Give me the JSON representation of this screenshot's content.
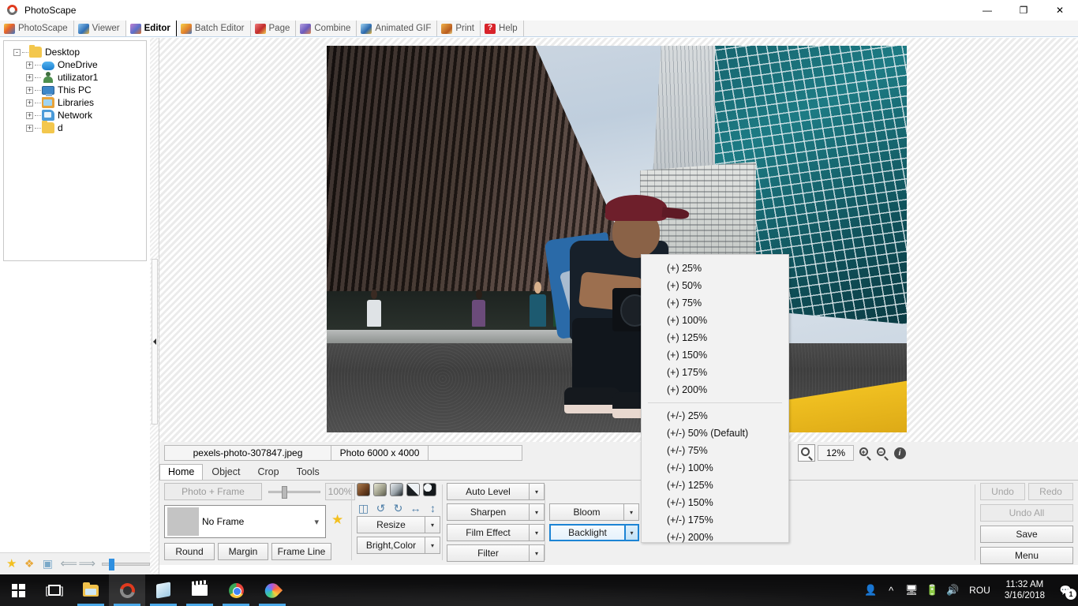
{
  "window": {
    "title": "PhotoScape",
    "app_icon": "photoscape-logo-icon",
    "controls": {
      "minimize": "—",
      "restore": "❐",
      "close": "✕"
    }
  },
  "module_tabs": [
    {
      "label": "PhotoScape",
      "icon": "photoscape-icon",
      "active": false
    },
    {
      "label": "Viewer",
      "icon": "viewer-icon",
      "active": false
    },
    {
      "label": "Editor",
      "icon": "editor-icon",
      "active": true
    },
    {
      "label": "Batch Editor",
      "icon": "batch-editor-icon",
      "active": false
    },
    {
      "label": "Page",
      "icon": "page-icon",
      "active": false
    },
    {
      "label": "Combine",
      "icon": "combine-icon",
      "active": false
    },
    {
      "label": "Animated GIF",
      "icon": "animated-gif-icon",
      "active": false
    },
    {
      "label": "Print",
      "icon": "print-icon",
      "active": false
    },
    {
      "label": "Help",
      "icon": "help-icon",
      "active": false
    }
  ],
  "file_tree": [
    {
      "label": "Desktop",
      "icon": "folder-icon",
      "depth": 0,
      "expander": "-"
    },
    {
      "label": "OneDrive",
      "icon": "onedrive-icon",
      "depth": 1,
      "expander": "+"
    },
    {
      "label": "utilizator1",
      "icon": "user-icon",
      "depth": 1,
      "expander": "+"
    },
    {
      "label": "This PC",
      "icon": "this-pc-icon",
      "depth": 1,
      "expander": "+"
    },
    {
      "label": "Libraries",
      "icon": "libraries-icon",
      "depth": 1,
      "expander": "+"
    },
    {
      "label": "Network",
      "icon": "network-icon",
      "depth": 1,
      "expander": "+"
    },
    {
      "label": "d",
      "icon": "folder-icon",
      "depth": 1,
      "expander": "+"
    }
  ],
  "left_strip_icons": [
    "favorites-star-icon",
    "plugin-puzzle-icon",
    "screen-capture-icon",
    "back-arrow-icon",
    "forward-arrow-icon"
  ],
  "status": {
    "filename": "pexels-photo-307847.jpeg",
    "dimensions": "Photo 6000 x 4000",
    "extra": "",
    "zoom_value": "12%",
    "zoom_icons": [
      "fit-to-window-icon",
      "zoom-in-icon",
      "zoom-out-icon",
      "image-info-icon"
    ]
  },
  "editor": {
    "tabs": [
      {
        "label": "Home",
        "active": true
      },
      {
        "label": "Object",
        "active": false
      },
      {
        "label": "Crop",
        "active": false
      },
      {
        "label": "Tools",
        "active": false
      }
    ],
    "photo_frame": {
      "button_label": "Photo + Frame",
      "button_disabled": true,
      "percent": "100%",
      "frame_select_value": "No Frame",
      "favorite_icon": "favorite-star-icon"
    },
    "frame_buttons": [
      "Round",
      "Margin",
      "Frame Line"
    ],
    "swatches": [
      "sepia-gradient-swatch",
      "olive-gradient-swatch",
      "steel-gradient-swatch",
      "diagonal-split-swatch",
      "circle-invert-swatch"
    ],
    "transform_icons": [
      "deskew-icon",
      "rotate-left-icon",
      "rotate-right-icon",
      "flip-horizontal-icon",
      "flip-vertical-icon"
    ],
    "column_a": [
      {
        "label": "Resize",
        "has_dropdown": true,
        "active": false
      },
      {
        "label": "Bright,Color",
        "has_dropdown": true,
        "active": false
      }
    ],
    "column_b": [
      {
        "label": "Auto Level",
        "has_dropdown": true,
        "active": false
      },
      {
        "label": "Sharpen",
        "has_dropdown": true,
        "active": false
      },
      {
        "label": "Film Effect",
        "has_dropdown": true,
        "active": false
      },
      {
        "label": "Filter",
        "has_dropdown": true,
        "active": false
      }
    ],
    "column_c": [
      {
        "label": "Bloom",
        "has_dropdown": true,
        "active": false
      },
      {
        "label": "Backlight",
        "has_dropdown": true,
        "active": true
      }
    ],
    "right_buttons": {
      "undo": "Undo",
      "redo": "Redo",
      "undo_all": "Undo All",
      "save": "Save",
      "menu": "Menu",
      "undo_disabled": true,
      "redo_disabled": true,
      "undo_all_disabled": true
    }
  },
  "context_menu": {
    "group_plus": [
      "(+) 25%",
      "(+) 50%",
      "(+) 75%",
      "(+) 100%",
      "(+) 125%",
      "(+) 150%",
      "(+) 175%",
      "(+) 200%"
    ],
    "group_plusminus": [
      "(+/-) 25%",
      "(+/-) 50% (Default)",
      "(+/-) 75%",
      "(+/-) 100%",
      "(+/-) 125%",
      "(+/-) 150%",
      "(+/-) 175%",
      "(+/-) 200%"
    ]
  },
  "taskbar": {
    "items": [
      {
        "name": "start-button",
        "icon": "windows-logo-icon",
        "running": false,
        "active": false
      },
      {
        "name": "task-view-button",
        "icon": "task-view-icon",
        "running": false,
        "active": false
      },
      {
        "name": "file-explorer",
        "icon": "file-explorer-icon",
        "running": true,
        "active": false
      },
      {
        "name": "photoscape-task",
        "icon": "photoscape-icon",
        "running": true,
        "active": true
      },
      {
        "name": "store-task",
        "icon": "microsoft-store-icon",
        "running": true,
        "active": false
      },
      {
        "name": "movies-task",
        "icon": "movies-tv-icon",
        "running": true,
        "active": false
      },
      {
        "name": "chrome-task",
        "icon": "chrome-icon",
        "running": true,
        "active": false
      },
      {
        "name": "photos-task",
        "icon": "photos-icon",
        "running": true,
        "active": false
      }
    ],
    "tray": {
      "people_icon": "people-icon",
      "chevron_icon": "show-hidden-icons-icon",
      "network_icon": "network-icon",
      "battery_icon": "battery-icon",
      "volume_icon": "volume-icon",
      "language": "ROU",
      "time": "11:32 AM",
      "date": "3/16/2018",
      "notifications_icon": "action-center-icon",
      "notifications_count": "1"
    }
  },
  "colors": {
    "accent": "#1c84d4",
    "taskbar": "#0d0d0e",
    "panel": "#f0f0f0",
    "menu_bg": "#f2f2f2"
  }
}
